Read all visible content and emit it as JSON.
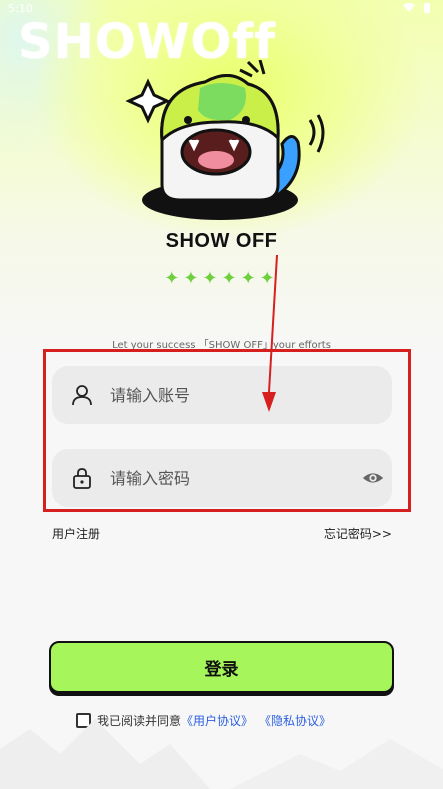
{
  "status_bar": {
    "time": "5:10"
  },
  "brand": {
    "wordmark": "SHOWOff",
    "logo_text": "SHOW OFF",
    "stars": "✦✦✦✦✦✦"
  },
  "tagline": "Let your success 「SHOW OFF」your efforts",
  "account_field": {
    "placeholder": "请输入账号",
    "value": ""
  },
  "password_field": {
    "placeholder": "请输入密码",
    "value": ""
  },
  "links": {
    "register": "用户注册",
    "forgot": "忘记密码>>"
  },
  "login_button": {
    "label": "登录"
  },
  "agreement": {
    "prefix": "我已阅读并同意",
    "user_agreement": "《用户协议》",
    "privacy_agreement": "《隐私协议》",
    "checked": false
  },
  "colors": {
    "accent_green": "#a6f55a",
    "highlight_red": "#d62020",
    "link_blue": "#2b5fe0"
  },
  "icons": [
    "user-icon",
    "lock-icon",
    "eye-icon",
    "wifi-icon",
    "battery-icon"
  ]
}
